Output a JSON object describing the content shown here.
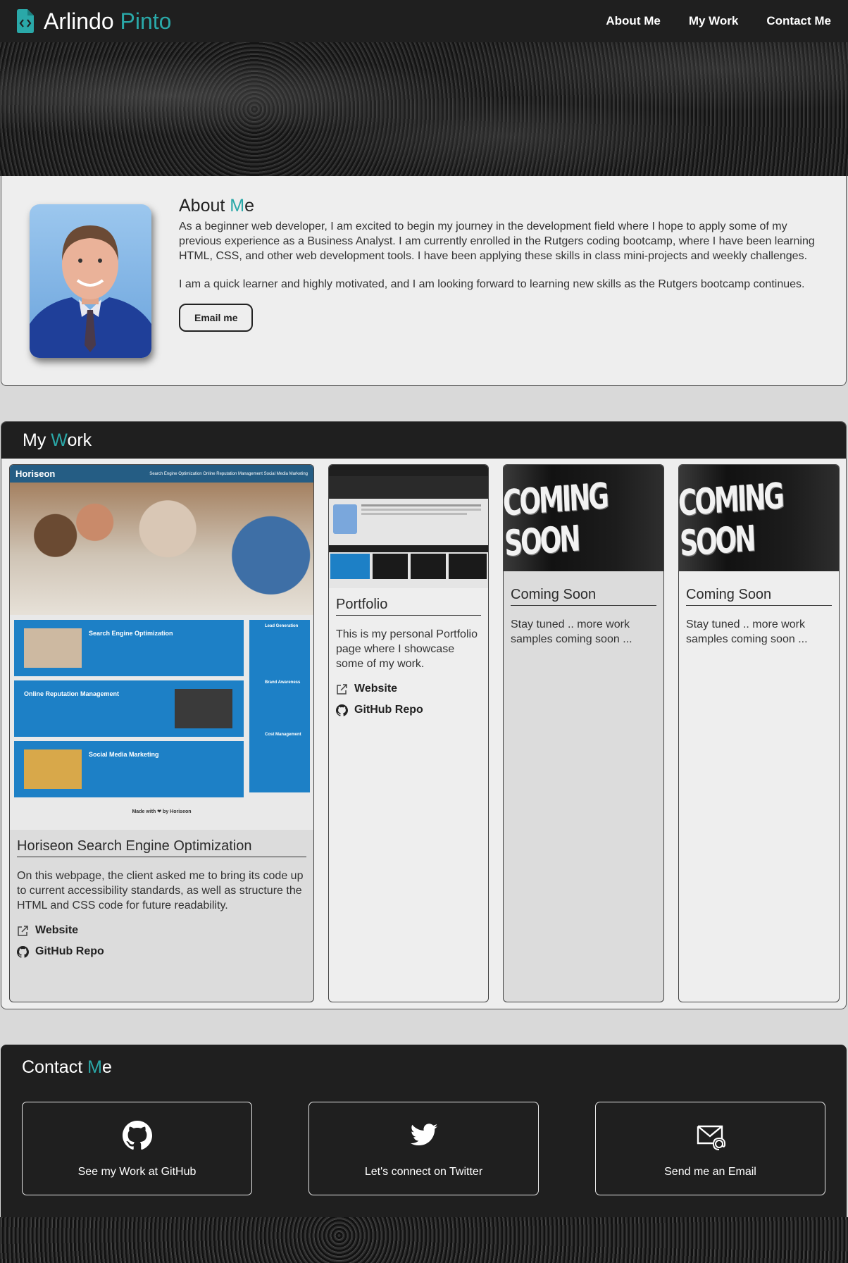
{
  "header": {
    "brand_first": "Arlindo",
    "brand_last": "Pinto",
    "nav": [
      "About Me",
      "My Work",
      "Contact Me"
    ]
  },
  "about": {
    "heading_a": "About ",
    "heading_b": "M",
    "heading_c": "e",
    "paragraph1": "As a beginner web developer, I am excited to begin my journey in the development field where I hope to apply some of my previous experience as a Business Analyst. I am currently enrolled in the Rutgers coding bootcamp, where I have been learning HTML, CSS, and other web development tools. I have been applying these skills in class mini-projects and weekly challenges.",
    "paragraph2": "I am a quick learner and highly motivated, and I am looking forward to learning new skills as the Rutgers bootcamp continues.",
    "button": "Email me"
  },
  "work": {
    "heading_a": "My ",
    "heading_b": "W",
    "heading_c": "ork",
    "cards": [
      {
        "title": "Horiseon Search Engine Optimization",
        "description": "On this webpage, the client asked me to bring its code up to current accessibility standards, as well as structure the HTML and CSS code for future readability.",
        "website": "Website",
        "repo": "GitHub Repo",
        "thumb": {
          "brand": "Horiseon",
          "nav": "Search Engine Optimization    Online Reputation Management    Social Media Marketing",
          "blocks": [
            "Search Engine Optimization",
            "Online Reputation Management",
            "Social Media Marketing"
          ],
          "side": [
            "Lead Generation",
            "Brand Awareness",
            "Cost Management"
          ],
          "footer": "Made with ❤ by Horiseon"
        }
      },
      {
        "title": "Portfolio",
        "description": "This is my personal Portfolio page where I showcase some of my work.",
        "website": "Website",
        "repo": "GitHub Repo"
      },
      {
        "title": "Coming Soon",
        "description": "Stay tuned .. more work samples coming soon ...",
        "image_text": "COMING SOON"
      },
      {
        "title": "Coming Soon",
        "description": "Stay tuned .. more work samples coming soon ...",
        "image_text": "COMING SOON"
      }
    ]
  },
  "contact": {
    "heading_a": "Contact ",
    "heading_b": "M",
    "heading_c": "e",
    "items": [
      {
        "label": "See my Work at GitHub",
        "icon": "github-icon"
      },
      {
        "label": "Let's connect on Twitter",
        "icon": "twitter-icon"
      },
      {
        "label": "Send me an Email",
        "icon": "email-icon"
      }
    ]
  },
  "colors": {
    "accent": "#2aa8a8",
    "dark": "#1f1f1f",
    "panel": "#eeeeee"
  }
}
